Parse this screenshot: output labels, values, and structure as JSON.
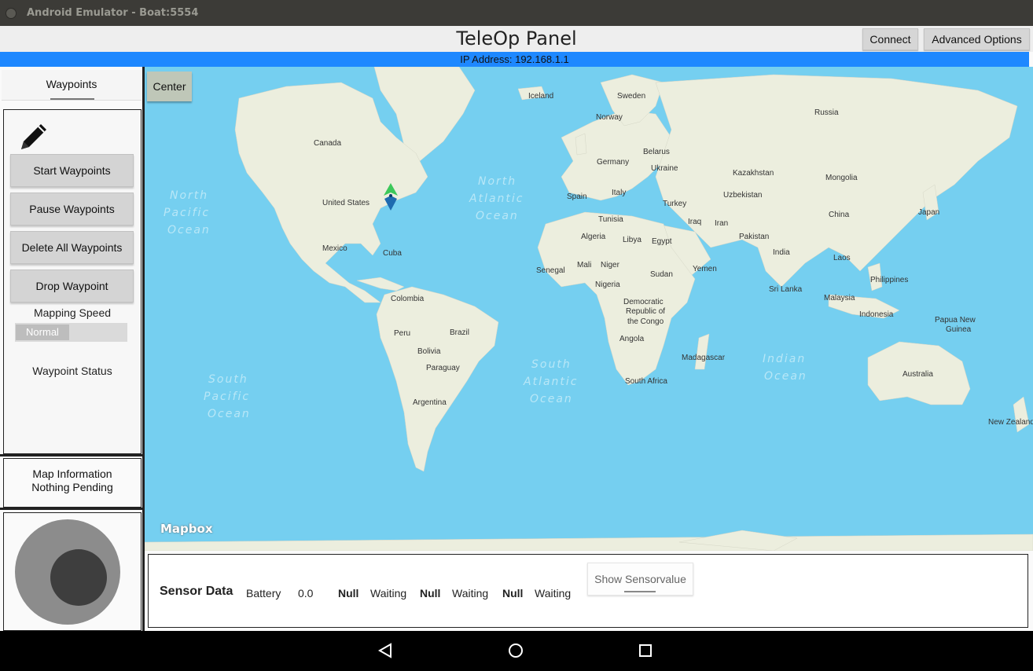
{
  "window": {
    "title": "Android Emulator - Boat:5554"
  },
  "appbar": {
    "title": "TeleOp Panel",
    "connect_label": "Connect",
    "advanced_label": "Advanced Options",
    "ip_text": "IP Address: 192.168.1.1"
  },
  "left": {
    "tab_label": "Waypoints",
    "buttons": [
      "Start Waypoints",
      "Pause Waypoints",
      "Delete All Waypoints",
      "Drop Waypoint"
    ],
    "mapping_speed_label": "Mapping Speed",
    "mapping_speed_value": "Normal",
    "waypoint_status_label": "Waypoint Status",
    "map_info_title": "Map Information",
    "map_info_status": "Nothing Pending"
  },
  "map": {
    "center_label": "Center",
    "attribution": "Mapbox",
    "oceans": [
      "North Pacific Ocean",
      "North Atlantic Ocean",
      "South Pacific Ocean",
      "South Atlantic Ocean",
      "Indian Ocean"
    ],
    "countries": [
      "Iceland",
      "Sweden",
      "Norway",
      "Russia",
      "Canada",
      "Belarus",
      "Germany",
      "Ukraine",
      "Kazakhstan",
      "Mongolia",
      "Spain",
      "Italy",
      "Uzbekistan",
      "Turkey",
      "United States",
      "China",
      "Japan",
      "Tunisia",
      "Iraq",
      "Iran",
      "Algeria",
      "Libya",
      "Egypt",
      "Pakistan",
      "Mexico",
      "Cuba",
      "India",
      "Laos",
      "Mali",
      "Niger",
      "Senegal",
      "Sudan",
      "Yemen",
      "Philippines",
      "Nigeria",
      "Sri Lanka",
      "Malaysia",
      "Colombia",
      "Democratic Republic of the Congo",
      "Indonesia",
      "Papua New Guinea",
      "Brazil",
      "Peru",
      "Angola",
      "Bolivia",
      "Paraguay",
      "Madagascar",
      "Australia",
      "South Africa",
      "Argentina",
      "New Zealand"
    ]
  },
  "sensor": {
    "title": "Sensor Data",
    "battery_label": "Battery",
    "battery_value": "0.0",
    "readings": [
      {
        "name": "Null",
        "value": "Waiting"
      },
      {
        "name": "Null",
        "value": "Waiting"
      },
      {
        "name": "Null",
        "value": "Waiting"
      }
    ],
    "show_button": "Show Sensorvalue"
  },
  "colors": {
    "accent": "#1e88ff",
    "ocean": "#75cff0",
    "land": "#ecefe0"
  }
}
